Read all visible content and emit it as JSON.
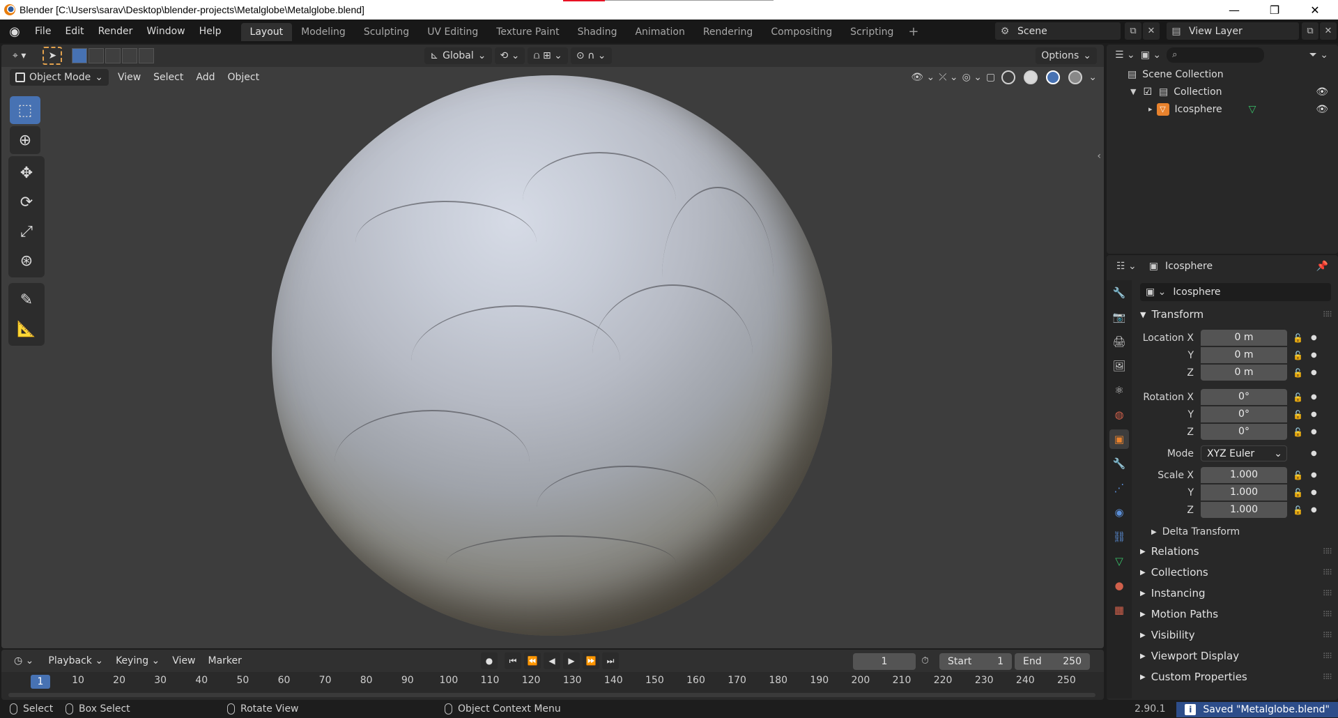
{
  "window": {
    "title": "Blender [C:\\Users\\sarav\\Desktop\\blender-projects\\Metalglobe\\Metalglobe.blend]",
    "controls": [
      "—",
      "❐",
      "✕"
    ]
  },
  "menubar": {
    "items": [
      "File",
      "Edit",
      "Render",
      "Window",
      "Help"
    ]
  },
  "workspaces": {
    "tabs": [
      "Layout",
      "Modeling",
      "Sculpting",
      "UV Editing",
      "Texture Paint",
      "Shading",
      "Animation",
      "Rendering",
      "Compositing",
      "Scripting"
    ],
    "active": "Layout",
    "add": "+"
  },
  "scene": {
    "name": "Scene"
  },
  "view_layer": {
    "name": "View Layer"
  },
  "viewport": {
    "orientation": "Global",
    "options_label": "Options",
    "mode": "Object Mode",
    "menus": [
      "View",
      "Select",
      "Add",
      "Object"
    ]
  },
  "tools": [
    "select-box",
    "cursor",
    "move",
    "rotate",
    "scale",
    "transform",
    "annotate",
    "measure"
  ],
  "timeline": {
    "menus": [
      "Playback",
      "Keying",
      "View",
      "Marker"
    ],
    "current_frame": "1",
    "start_label": "Start",
    "start_value": "1",
    "end_label": "End",
    "end_value": "250",
    "ruler": [
      "10",
      "20",
      "30",
      "40",
      "50",
      "60",
      "70",
      "80",
      "90",
      "100",
      "110",
      "120",
      "130",
      "140",
      "150",
      "160",
      "170",
      "180",
      "190",
      "200",
      "210",
      "220",
      "230",
      "240",
      "250"
    ],
    "ruler_current": "1"
  },
  "statusbar": {
    "select": "Select",
    "box_select": "Box Select",
    "rotate_view": "Rotate View",
    "context_menu": "Object Context Menu",
    "version": "2.90.1",
    "saved": "Saved \"Metalglobe.blend\""
  },
  "outliner": {
    "scene_collection": "Scene Collection",
    "collection": "Collection",
    "object": "Icosphere"
  },
  "properties": {
    "object_title": "Icosphere",
    "object_name": "Icosphere",
    "transform_label": "Transform",
    "location_label": "Location X",
    "location": [
      "0 m",
      "0 m",
      "0 m"
    ],
    "rotation_label": "Rotation X",
    "rotation": [
      "0°",
      "0°",
      "0°"
    ],
    "y_label": "Y",
    "z_label": "Z",
    "mode_label": "Mode",
    "mode_value": "XYZ Euler",
    "scale_label": "Scale X",
    "scale": [
      "1.000",
      "1.000",
      "1.000"
    ],
    "delta_transform": "Delta Transform",
    "panels": [
      "Relations",
      "Collections",
      "Instancing",
      "Motion Paths",
      "Visibility",
      "Viewport Display",
      "Custom Properties"
    ]
  },
  "colors": {
    "accent_blue": "#4772b3",
    "object_orange": "#e8822d",
    "mesh_green": "#39c26a"
  }
}
